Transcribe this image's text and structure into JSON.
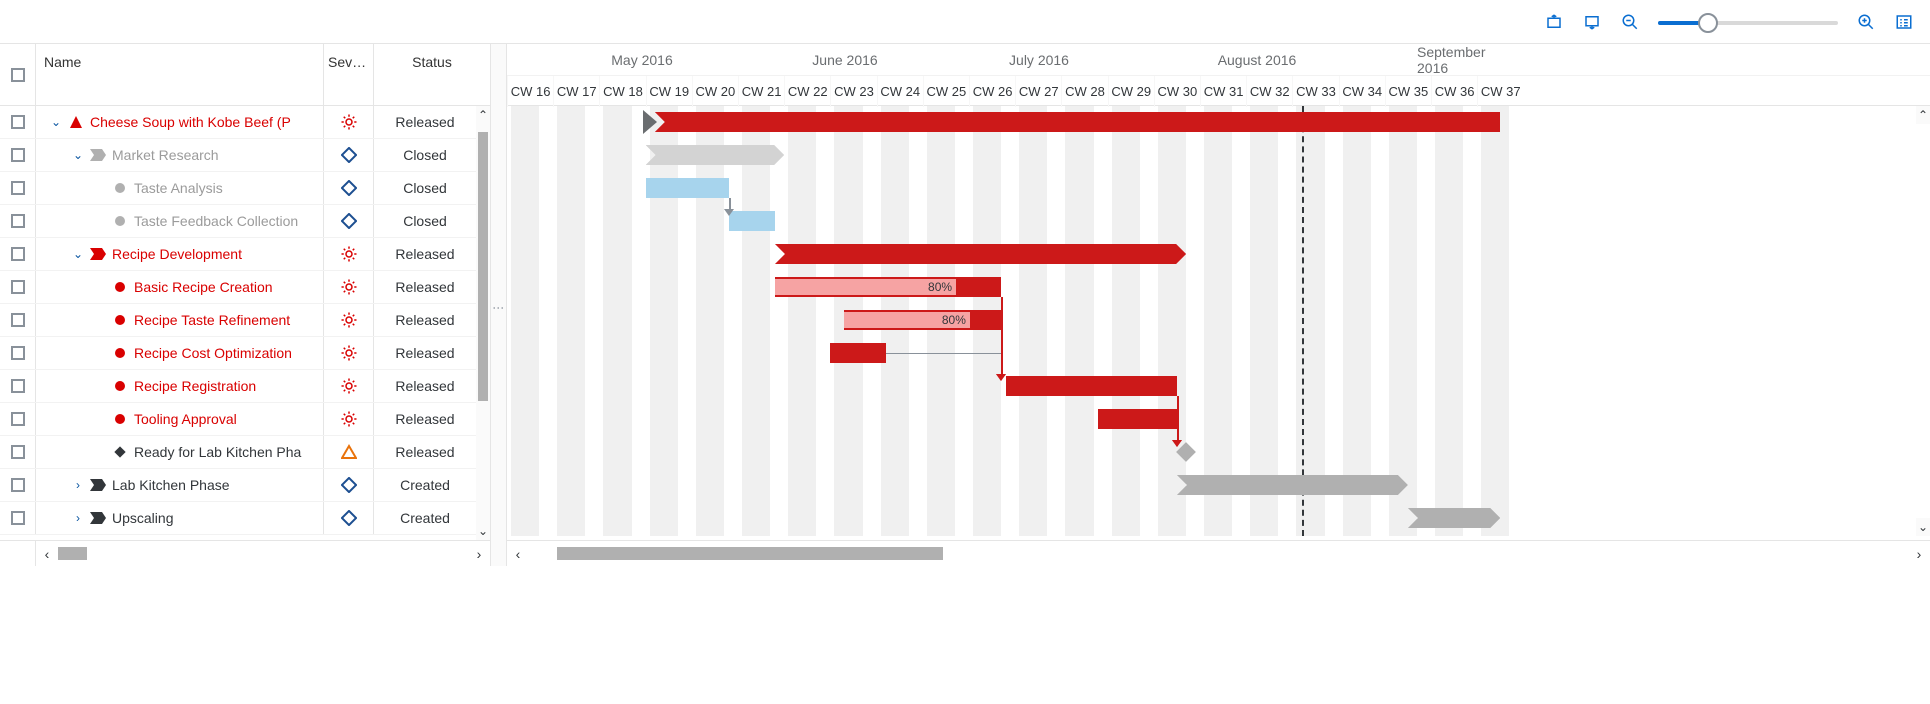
{
  "toolbar": {
    "icons": [
      "collapse-all",
      "expand-all",
      "zoom-out",
      "zoom-slider",
      "zoom-in",
      "legend"
    ]
  },
  "columns": {
    "name": "Name",
    "sev": "Sev…",
    "status": "Status"
  },
  "rows": [
    {
      "indent": 0,
      "exp": "down",
      "icon": "triangle",
      "iconColor": "red",
      "label": "Cheese Soup with Kobe Beef (P",
      "txt": "red",
      "sev": "sun-red",
      "status": "Released"
    },
    {
      "indent": 1,
      "exp": "down",
      "icon": "tag",
      "iconColor": "grey",
      "label": "Market Research",
      "txt": "grey",
      "sev": "diamond-blue",
      "status": "Closed"
    },
    {
      "indent": 2,
      "exp": "",
      "icon": "dot",
      "iconColor": "grey",
      "label": "Taste Analysis",
      "txt": "grey",
      "sev": "diamond-blue",
      "status": "Closed"
    },
    {
      "indent": 2,
      "exp": "",
      "icon": "dot",
      "iconColor": "grey",
      "label": "Taste Feedback Collection",
      "txt": "grey",
      "sev": "diamond-blue",
      "status": "Closed"
    },
    {
      "indent": 1,
      "exp": "down",
      "icon": "tag",
      "iconColor": "red",
      "label": "Recipe Development",
      "txt": "red",
      "sev": "sun-red",
      "status": "Released"
    },
    {
      "indent": 2,
      "exp": "",
      "icon": "dot",
      "iconColor": "red",
      "label": "Basic Recipe Creation",
      "txt": "red",
      "sev": "sun-red",
      "status": "Released"
    },
    {
      "indent": 2,
      "exp": "",
      "icon": "dot",
      "iconColor": "red",
      "label": "Recipe Taste Refinement",
      "txt": "red",
      "sev": "sun-red",
      "status": "Released"
    },
    {
      "indent": 2,
      "exp": "",
      "icon": "dot",
      "iconColor": "red",
      "label": "Recipe Cost Optimization",
      "txt": "red",
      "sev": "sun-red",
      "status": "Released"
    },
    {
      "indent": 2,
      "exp": "",
      "icon": "dot",
      "iconColor": "red",
      "label": "Recipe Registration",
      "txt": "red",
      "sev": "sun-red",
      "status": "Released"
    },
    {
      "indent": 2,
      "exp": "",
      "icon": "dot",
      "iconColor": "red",
      "label": "Tooling Approval",
      "txt": "red",
      "sev": "sun-red",
      "status": "Released"
    },
    {
      "indent": 2,
      "exp": "",
      "icon": "diamond",
      "iconColor": "dark",
      "label": "Ready for Lab Kitchen Pha",
      "txt": "dark",
      "sev": "triangle-orange",
      "status": "Released"
    },
    {
      "indent": 1,
      "exp": "right",
      "icon": "tag",
      "iconColor": "dark",
      "label": "Lab Kitchen Phase",
      "txt": "dark",
      "sev": "diamond-blue",
      "status": "Created"
    },
    {
      "indent": 1,
      "exp": "right",
      "icon": "tag",
      "iconColor": "dark",
      "label": "Upscaling",
      "txt": "dark",
      "sev": "diamond-blue",
      "status": "Created"
    }
  ],
  "months": [
    {
      "label": "May 2016",
      "center": 135
    },
    {
      "label": "June 2016",
      "center": 338
    },
    {
      "label": "July 2016",
      "center": 532
    },
    {
      "label": "August 2016",
      "center": 750
    },
    {
      "label": "September 2016",
      "center": 960
    }
  ],
  "weekStart": 16,
  "weekCount": 22,
  "weekWidth": 46.2,
  "todayWeekIndex": 17.2,
  "chart_data": {
    "type": "gantt",
    "unit": "calendar-week-2016",
    "tasks": [
      {
        "row": 0,
        "name": "Cheese Soup with Kobe Beef",
        "type": "summary",
        "start": 19.2,
        "end": 37.5,
        "color": "red"
      },
      {
        "row": 1,
        "name": "Market Research",
        "type": "summary",
        "start": 19.0,
        "end": 22.0,
        "color": "grey"
      },
      {
        "row": 2,
        "name": "Taste Analysis",
        "type": "task",
        "start": 19.0,
        "end": 20.8,
        "color": "blue"
      },
      {
        "row": 3,
        "name": "Taste Feedback Collection",
        "type": "task",
        "start": 20.8,
        "end": 21.8,
        "color": "blue"
      },
      {
        "row": 4,
        "name": "Recipe Development",
        "type": "summary",
        "start": 21.8,
        "end": 30.7,
        "color": "red"
      },
      {
        "row": 5,
        "name": "Basic Recipe Creation",
        "type": "task",
        "start": 21.8,
        "end": 26.7,
        "progress": 80,
        "color": "red"
      },
      {
        "row": 6,
        "name": "Recipe Taste Refinement",
        "type": "task",
        "start": 23.3,
        "end": 26.7,
        "progress": 80,
        "color": "red"
      },
      {
        "row": 7,
        "name": "Recipe Cost Optimization",
        "type": "task",
        "start": 23.0,
        "end": 24.2,
        "color": "red"
      },
      {
        "row": 8,
        "name": "Recipe Registration",
        "type": "task",
        "start": 26.8,
        "end": 30.5,
        "color": "red"
      },
      {
        "row": 9,
        "name": "Tooling Approval",
        "type": "task",
        "start": 28.8,
        "end": 30.5,
        "color": "red"
      },
      {
        "row": 10,
        "name": "Ready for Lab Kitchen Phase",
        "type": "milestone",
        "at": 30.7,
        "color": "grey"
      },
      {
        "row": 11,
        "name": "Lab Kitchen Phase",
        "type": "summary",
        "start": 30.5,
        "end": 35.5,
        "color": "grey"
      },
      {
        "row": 12,
        "name": "Upscaling",
        "type": "summary",
        "start": 35.5,
        "end": 37.5,
        "color": "grey"
      }
    ],
    "dependencies": [
      {
        "from": 2,
        "to": 3
      },
      {
        "from": 5,
        "to": 8
      },
      {
        "from": 6,
        "to": 8
      },
      {
        "from": 8,
        "to": 10
      },
      {
        "from": 9,
        "to": 10
      }
    ],
    "grey_link": {
      "from_row": 7,
      "from_cw": 24.2,
      "to_cw": 26.7
    }
  },
  "percent_80": "80%"
}
